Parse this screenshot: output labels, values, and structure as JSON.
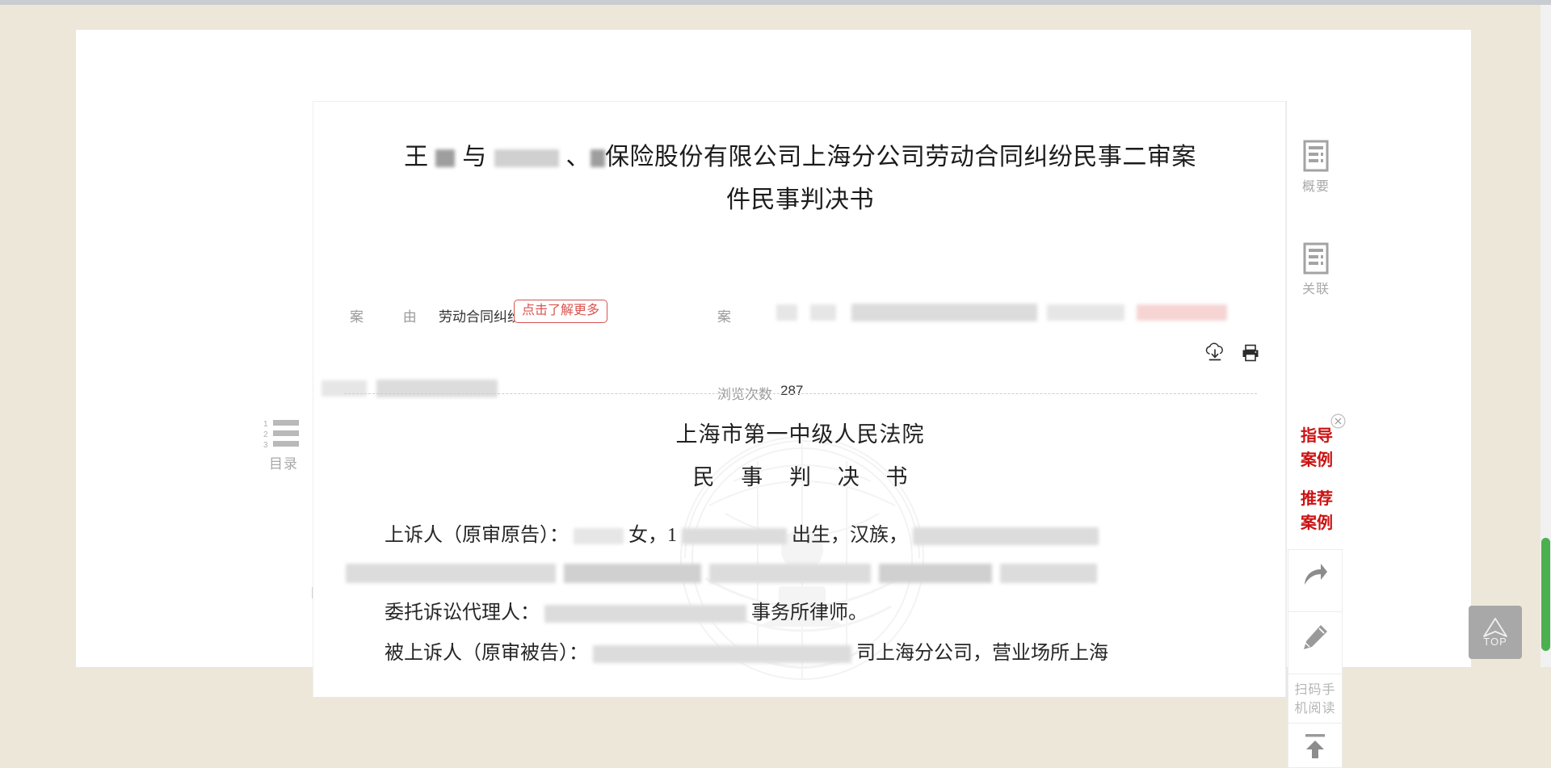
{
  "window": {
    "background_color": "#ede7da",
    "page_background": "#ffffff"
  },
  "document": {
    "title_line1_prefix": "王",
    "title_line1_mid": "与",
    "title_line1_rest": "保险股份有限公司上海分公司劳动合同纠纷民事二审案",
    "title_line2": "件民事判决书",
    "court_name": "上海市第一中级人民法院",
    "doc_type": "民 事 判 决 书",
    "watermark_icon": "court-seal-watermark"
  },
  "meta": {
    "cause_label": "案 由",
    "cause_value": "劳动合同纠纷",
    "tooltip_more": "点击了解更多",
    "case_no_label": "案 号",
    "case_no_value_redacted": true,
    "row2_label_redacted": true,
    "views_label": "浏览次数",
    "views_count": "287"
  },
  "actions": [
    {
      "name": "download-icon",
      "label": "下载"
    },
    {
      "name": "print-icon",
      "label": "打印"
    }
  ],
  "body_paragraphs": [
    {
      "id": "appellant",
      "prefix": "上诉人（原审原告）：",
      "after_redact1": "女，1",
      "after_redact2": "出生，汉族，",
      "trailing_redacted": true
    },
    {
      "id": "full-redacted-line",
      "fully_redacted": true
    },
    {
      "id": "agent",
      "prefix": "委托诉讼代理人：",
      "suffix": "事务所律师。"
    },
    {
      "id": "respondent",
      "prefix": "被上诉人（原审被告）：",
      "suffix": "司上海分公司，营业场所上海"
    }
  ],
  "left_rail": {
    "toc_icon": "numbered-list-icon",
    "toc_label": "目录"
  },
  "right_rail": {
    "items": [
      {
        "name": "summary",
        "icon": "document-lines-icon",
        "label": "概要"
      },
      {
        "name": "related",
        "icon": "document-lines-icon",
        "label": "关联"
      }
    ],
    "promos": [
      {
        "name": "guiding-case",
        "line1": "指导",
        "line2": "案例",
        "color": "#cc1111"
      },
      {
        "name": "recommended-case",
        "line1": "推荐",
        "line2": "案例",
        "color": "#cc1111"
      }
    ],
    "close_icon": "close-circle-icon",
    "tools": [
      {
        "name": "share",
        "icon": "share-arrow-icon"
      },
      {
        "name": "edit",
        "icon": "pencil-icon"
      },
      {
        "name": "qr-read",
        "icon": "qr-text",
        "line1": "扫码手",
        "line2": "机阅读"
      },
      {
        "name": "scroll-top-small",
        "icon": "arrow-up-bar-icon"
      }
    ]
  },
  "floating": {
    "top_button_label": "TOP",
    "top_button_icon": "chevron-up-icon"
  },
  "scrollbar": {
    "thumb_color": "#4caf50",
    "track_color": "#f1f1f1"
  }
}
